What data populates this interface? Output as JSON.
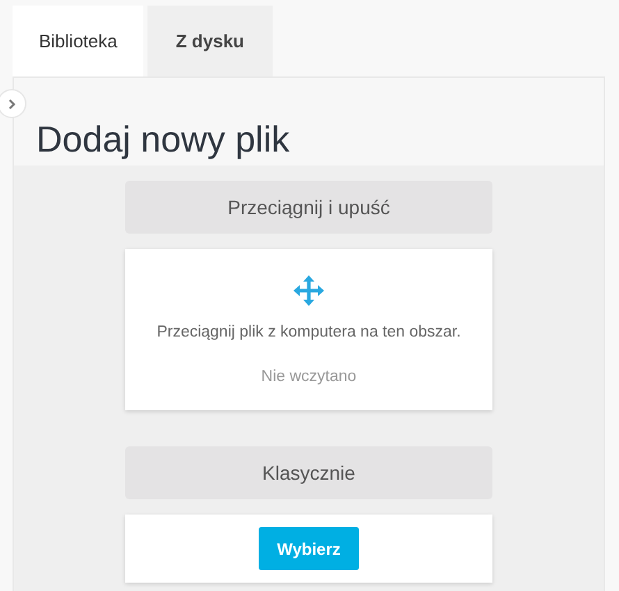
{
  "tabs": [
    {
      "label": "Biblioteka",
      "selected": true
    },
    {
      "label": "Z dysku",
      "selected": false
    }
  ],
  "panel": {
    "title": "Dodaj nowy plik",
    "sidebar_expanded": false
  },
  "sections": [
    {
      "kind": "dropzone",
      "heading": "Przeciągnij i upuść",
      "hint": "Przeciągnij plik z komputera na ten obszar.",
      "status": "Nie wczytano"
    },
    {
      "kind": "classic",
      "heading": "Klasycznie",
      "button": "Wybierz"
    }
  ]
}
